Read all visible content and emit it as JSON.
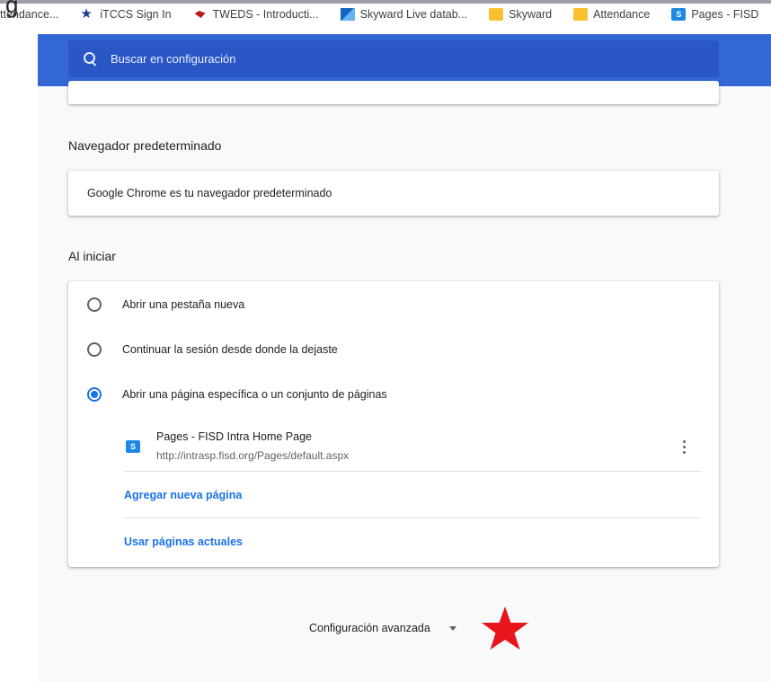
{
  "bookmarks": {
    "ghost_text": "g",
    "items": [
      {
        "label": "ttendance...",
        "icon": "none"
      },
      {
        "label": "iTCCS Sign In",
        "icon": "star-icon"
      },
      {
        "label": "TWEDS - Introducti...",
        "icon": "texas-icon"
      },
      {
        "label": "Skyward Live datab...",
        "icon": "skyward-icon"
      },
      {
        "label": "Skyward",
        "icon": "folder-icon"
      },
      {
        "label": "Attendance",
        "icon": "folder-icon"
      },
      {
        "label": "Pages - FISD",
        "icon": "sharepoint-icon"
      }
    ]
  },
  "header": {
    "search_placeholder": "Buscar en configuración"
  },
  "default_browser": {
    "title": "Navegador predeterminado",
    "status": "Google Chrome es tu navegador predeterminado"
  },
  "startup": {
    "title": "Al iniciar",
    "options": [
      {
        "label": "Abrir una pestaña nueva",
        "checked": false
      },
      {
        "label": "Continuar la sesión desde donde la dejaste",
        "checked": false
      },
      {
        "label": "Abrir una página específica o un conjunto de páginas",
        "checked": true
      }
    ],
    "page": {
      "icon_text": "S",
      "name": "Pages - FISD Intra Home Page",
      "url": "http://intrasp.fisd.org/Pages/default.aspx"
    },
    "add_page": "Agregar nueva página",
    "use_current": "Usar páginas actuales"
  },
  "advanced": {
    "label": "Configuración avanzada"
  },
  "colors": {
    "header": "#3367d6",
    "search": "#2a56c6",
    "accent": "#1a73e8",
    "annotation_star": "#e8161c"
  }
}
